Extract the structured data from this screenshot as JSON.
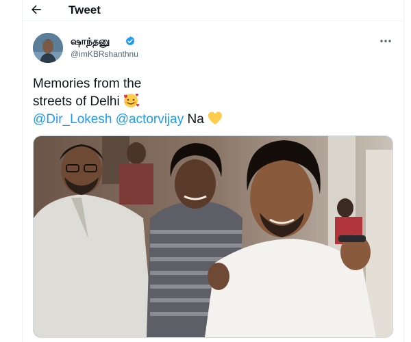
{
  "header": {
    "title": "Tweet",
    "back_icon": "arrow-left-icon"
  },
  "author": {
    "display_name": "ஷாந்தனு",
    "handle": "@imKBRshanthnu",
    "verified": true,
    "verified_color": "#1d9bf0"
  },
  "tweet": {
    "line1": "Memories from the",
    "line2": "streets of Delhi",
    "line2_emoji": "smiling-face-with-hearts-icon",
    "mention1": "@Dir_Lokesh",
    "mention2": "@actorvijay",
    "suffix": "Na",
    "suffix_emoji": "yellow-heart-icon"
  },
  "media": {
    "type": "photo",
    "content": "three-men-selfie-photo"
  },
  "colors": {
    "link": "#1d9bf0",
    "text": "#0f1419",
    "muted": "#536471"
  }
}
